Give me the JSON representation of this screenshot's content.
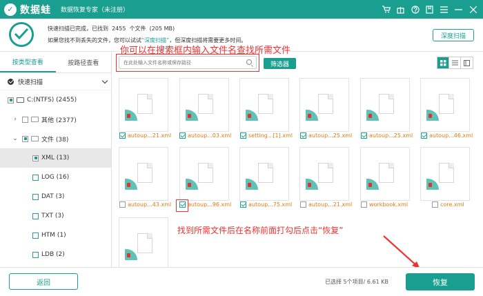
{
  "app": {
    "logo_glyph": "✓",
    "brand": "数据蛙",
    "subtitle": "数据恢复专家（未注册）",
    "accent_color": "#1a9e8f",
    "window_icons": [
      "cart-icon",
      "gift-icon",
      "help-icon",
      "bookmark-icon",
      "menu-icon",
      "minimize-icon",
      "close-icon"
    ]
  },
  "info": {
    "line1_prefix": "快速扫描已完成，已找到",
    "file_count": "2455",
    "line1_mid": "个文件",
    "size": "(205 MB)",
    "line2_prefix": "如果您找不到丢失的文件，您可以试试",
    "deep_link": "“深度扫描”",
    "line2_suffix": "，但深度扫描将需要更多时间。",
    "deep_button": "深度扫描"
  },
  "sidebar": {
    "tabs": [
      {
        "label": "按类型查看",
        "active": true
      },
      {
        "label": "按路径查看",
        "active": false
      }
    ],
    "quick_scan": "快速扫描",
    "tree": [
      {
        "label": "C:(NTFS) (2455)"
      },
      {
        "label": "其他 (2377)"
      },
      {
        "label": "文件 (38)"
      },
      {
        "label": "XML (13)"
      },
      {
        "label": "LOG (16)"
      },
      {
        "label": "DAT (3)"
      },
      {
        "label": "TXT (3)"
      },
      {
        "label": "HTM (1)"
      },
      {
        "label": "LDB (2)"
      }
    ]
  },
  "toolbar": {
    "search_placeholder": "在此处输入文件名称或保存路径",
    "filter_button": "筛选器",
    "annotation": "你可以在搜索框内输入文件名查找所需文件"
  },
  "files": [
    {
      "name": "autoup...21.xml",
      "checked": true
    },
    {
      "name": "autoup...03.xml",
      "checked": true
    },
    {
      "name": "setting...[1].xml",
      "checked": true
    },
    {
      "name": "autoup...25.xml",
      "checked": true
    },
    {
      "name": "autoup...25.xml",
      "checked": true
    },
    {
      "name": "autoup...46.xml",
      "checked": true
    },
    {
      "name": "autoup...43.xml",
      "checked": false
    },
    {
      "name": "autoup...96.xml",
      "checked": true
    },
    {
      "name": "autoup...75.xml",
      "checked": true
    },
    {
      "name": "autoup...21.xml",
      "checked": false
    },
    {
      "name": "workbook.xml",
      "checked": false
    },
    {
      "name": "core.xml",
      "checked": false
    }
  ],
  "annotation_bottom": "找到所需文件后在名称前面打勾后点击“恢复”",
  "footer": {
    "back_button": "返回",
    "selected_info": "已选择 5个项目/ 6.61 KB",
    "recover_button": "恢复"
  }
}
